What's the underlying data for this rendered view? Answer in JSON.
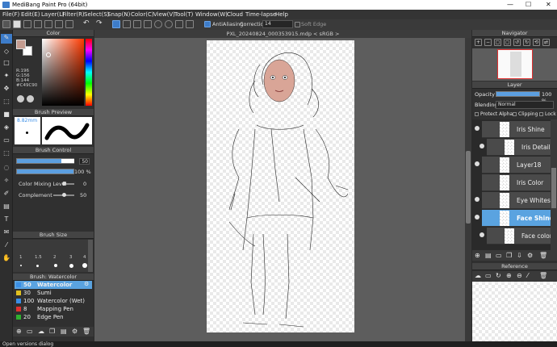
{
  "window": {
    "title": "MediBang Paint Pro (64bit)",
    "minimize": "—",
    "maximize": "☐",
    "close": "✕"
  },
  "menu": [
    "File(F)",
    "Edit(E)",
    "Layer(L)",
    "Filter(R)",
    "Select(S)",
    "Snap(N)",
    "Color(C)",
    "View(V)",
    "Tool(T)",
    "Window(W)",
    "Cloud",
    "Time-lapse",
    "Help"
  ],
  "toolbar": {
    "antialiasing": "AntiAliasing",
    "correction_label": "Correction",
    "correction_value": "14",
    "soft_edge": "Soft Edge"
  },
  "color": {
    "title": "Color",
    "r": "R:196",
    "g": "G:156",
    "b": "B:144",
    "hex": "#C49C90",
    "fg": "#c49c90",
    "bg": "#ffffff"
  },
  "brush_preview": {
    "title": "Brush Preview",
    "size": "8.82mm"
  },
  "brush_control": {
    "title": "Brush Control",
    "size_value": "50",
    "opacity_value": "100 %",
    "mixing_label": "Color Mixing Level",
    "mixing_value": "0",
    "complement_label": "Complement",
    "complement_value": "50"
  },
  "brush_size": {
    "title": "Brush Size",
    "labels": [
      "1",
      "1.5",
      "2",
      "3",
      "4"
    ]
  },
  "brush_list": {
    "title": "Brush: Watercolor",
    "items": [
      {
        "num": "50",
        "name": "Watercolor",
        "color": "#3a8ee6",
        "selected": true
      },
      {
        "num": "30",
        "name": "Sumi",
        "color": "#e0c020"
      },
      {
        "num": "100",
        "name": "Watercolor (Wet)",
        "color": "#3a8ee6"
      },
      {
        "num": "8",
        "name": "Mapping Pen",
        "color": "#e03030"
      },
      {
        "num": "20",
        "name": "Edge Pen",
        "color": "#30b030"
      }
    ]
  },
  "document": {
    "tab": "PXL_20240824_000353915.mdp < sRGB >"
  },
  "navigator": {
    "title": "Navigator"
  },
  "layer": {
    "title": "Layer",
    "opacity_label": "Opacity",
    "opacity_value": "100 %",
    "blending_label": "Blending",
    "blending_value": "Normal",
    "protect_alpha": "Protect Alpha",
    "clipping": "Clipping",
    "lock": "Lock",
    "items": [
      {
        "name": "Iris Shine",
        "selected": false
      },
      {
        "name": "Iris Details",
        "selected": false
      },
      {
        "name": "Layer18",
        "selected": false
      },
      {
        "name": "Iris Color",
        "selected": false
      },
      {
        "name": "Eye Whites",
        "selected": false
      },
      {
        "name": "Face Shine",
        "selected": true
      },
      {
        "name": "Face color",
        "selected": false
      }
    ]
  },
  "reference": {
    "title": "Reference"
  },
  "status": {
    "text": "Open versions dialog"
  }
}
